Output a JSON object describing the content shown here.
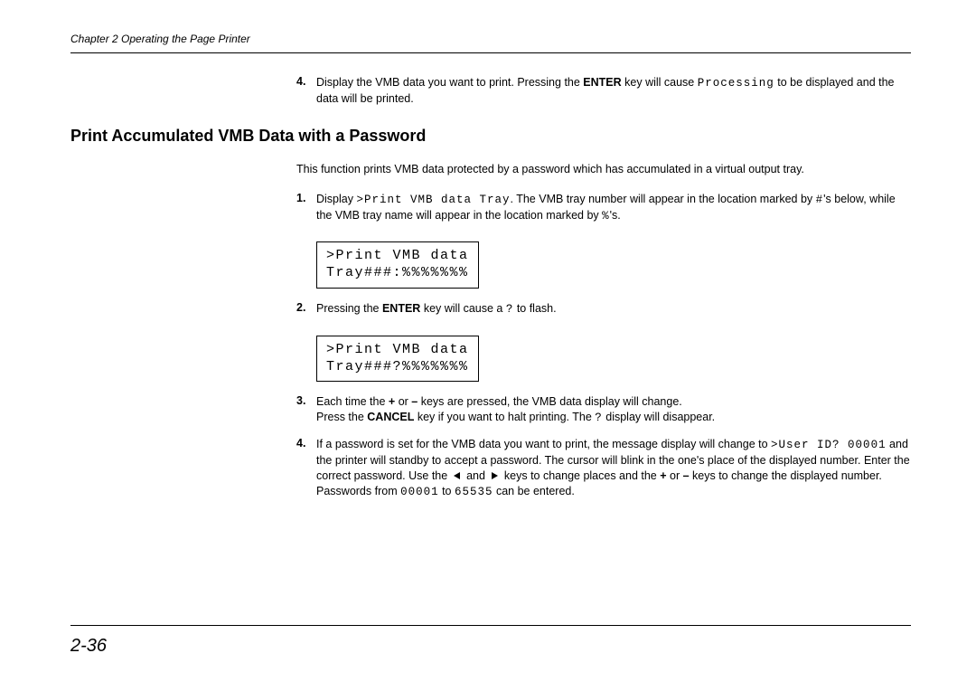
{
  "chapter_header": "Chapter 2  Operating the Page Printer",
  "prev_step": {
    "num": "4.",
    "text_before_enter": "Display the VMB data you want to print. Pressing the ",
    "enter": "ENTER",
    "text_after_enter": " key will cause ",
    "mono1": "Processing",
    "text_end": " to be displayed and the data will be printed."
  },
  "section_title": "Print Accumulated VMB Data with a Password",
  "intro": "This function prints VMB data protected by a password which has accumulated in a virtual output tray.",
  "steps": {
    "s1": {
      "num": "1.",
      "pre": "Display ",
      "mono": ">Print VMB data Tray",
      "post1": ". The VMB tray number will appear in the location marked by ",
      "hash": "#",
      "post2": "'s below, while the VMB tray name will appear in the location marked by ",
      "pct": "%",
      "post3": "'s."
    },
    "lcd1_line1": ">Print VMB data",
    "lcd1_line2": "Tray###:%%%%%%%",
    "s2": {
      "num": "2.",
      "pre": "Pressing the ",
      "enter": "ENTER",
      "mid": " key will cause a ",
      "q": "?",
      "post": " to flash."
    },
    "lcd2_line1": ">Print VMB data",
    "lcd2_line2": "Tray###?%%%%%%%",
    "s3": {
      "num": "3.",
      "l1a": "Each time the ",
      "plus": "+",
      "l1b": " or ",
      "minus": "–",
      "l1c": " keys are pressed, the VMB data display will change.",
      "l2a": "Press the ",
      "cancel": "CANCEL",
      "l2b": " key if you want to halt printing. The ",
      "q": "?",
      "l2c": " display will disappear."
    },
    "s4": {
      "num": "4.",
      "a": "If a password is set for the VMB data you want to print, the message display will change to ",
      "userid_mono": ">User ID? 00001",
      "b": " and the printer will standby to accept a password. The cursor will blink in the one's place of the displayed number. Enter the correct password. Use the ",
      "c": " and ",
      "d": " keys to change places and the ",
      "plus": "+",
      "e": " or ",
      "minus": "–",
      "f": " keys to change the displayed number. Passwords from ",
      "p1": "00001",
      "g": " to ",
      "p2": "65535",
      "h": " can be entered."
    }
  },
  "page_number": "2-36"
}
